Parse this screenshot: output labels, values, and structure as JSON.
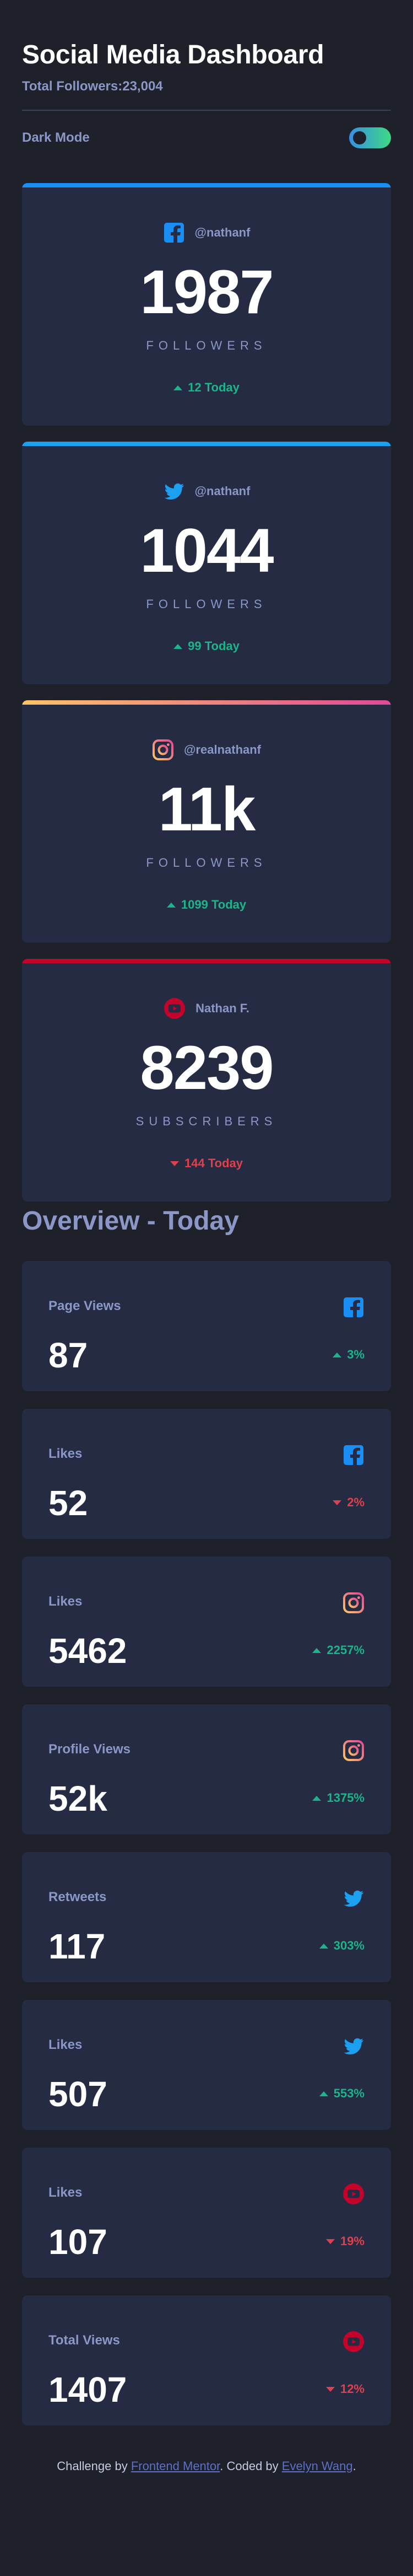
{
  "header": {
    "title": "Social Media Dashboard",
    "total_followers": "Total Followers:23,004"
  },
  "mode": {
    "label": "Dark Mode",
    "enabled": true
  },
  "colors": {
    "facebook": "#198ff5",
    "twitter": "#1ca0f2",
    "instagram_start": "#fdc468",
    "instagram_end": "#df4996",
    "youtube": "#c4032a",
    "up": "#1db489",
    "down": "#dc414c"
  },
  "followers": [
    {
      "platform": "facebook",
      "icon": "facebook-icon",
      "handle": "@nathanf",
      "count": "1987",
      "unit": "Followers",
      "change": "12 Today",
      "direction": "up"
    },
    {
      "platform": "twitter",
      "icon": "twitter-icon",
      "handle": "@nathanf",
      "count": "1044",
      "unit": "Followers",
      "change": "99 Today",
      "direction": "up"
    },
    {
      "platform": "instagram",
      "icon": "instagram-icon",
      "handle": "@realnathanf",
      "count": "11k",
      "unit": "Followers",
      "change": "1099 Today",
      "direction": "up"
    },
    {
      "platform": "youtube",
      "icon": "youtube-icon",
      "handle": "Nathan F.",
      "count": "8239",
      "unit": "Subscribers",
      "change": "144 Today",
      "direction": "down"
    }
  ],
  "overview": {
    "title": "Overview - Today",
    "cards": [
      {
        "label": "Page Views",
        "platform": "facebook",
        "icon": "facebook-icon",
        "value": "87",
        "change": "3%",
        "direction": "up"
      },
      {
        "label": "Likes",
        "platform": "facebook",
        "icon": "facebook-icon",
        "value": "52",
        "change": "2%",
        "direction": "down"
      },
      {
        "label": "Likes",
        "platform": "instagram",
        "icon": "instagram-icon",
        "value": "5462",
        "change": "2257%",
        "direction": "up"
      },
      {
        "label": "Profile Views",
        "platform": "instagram",
        "icon": "instagram-icon",
        "value": "52k",
        "change": "1375%",
        "direction": "up"
      },
      {
        "label": "Retweets",
        "platform": "twitter",
        "icon": "twitter-icon",
        "value": "117",
        "change": "303%",
        "direction": "up"
      },
      {
        "label": "Likes",
        "platform": "twitter",
        "icon": "twitter-icon",
        "value": "507",
        "change": "553%",
        "direction": "up"
      },
      {
        "label": "Likes",
        "platform": "youtube",
        "icon": "youtube-icon",
        "value": "107",
        "change": "19%",
        "direction": "down"
      },
      {
        "label": "Total Views",
        "platform": "youtube",
        "icon": "youtube-icon",
        "value": "1407",
        "change": "12%",
        "direction": "down"
      }
    ]
  },
  "footer": {
    "prefix": "Challenge by ",
    "link1": "Frontend Mentor",
    "middle": ". Coded by ",
    "link2": "Evelyn Wang",
    "suffix": "."
  }
}
